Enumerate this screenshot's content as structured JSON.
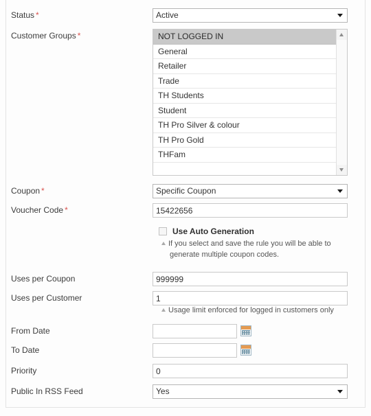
{
  "form": {
    "rows": [
      {
        "id": "status",
        "label": "Status",
        "required": true,
        "type": "select",
        "value": "Active"
      },
      {
        "id": "customer_groups",
        "label": "Customer Groups",
        "required": true,
        "type": "multiselect",
        "options": [
          "NOT LOGGED IN",
          "General",
          "Retailer",
          "Trade",
          "TH Students",
          "Student",
          "TH Pro Silver & colour",
          "TH Pro Gold",
          "THFam"
        ],
        "selected": [
          "NOT LOGGED IN"
        ]
      },
      {
        "id": "coupon",
        "label": "Coupon",
        "required": true,
        "type": "select",
        "value": "Specific Coupon"
      },
      {
        "id": "voucher_code",
        "label": "Voucher Code",
        "required": true,
        "type": "text",
        "value": "15422656"
      },
      {
        "id": "use_auto_generation",
        "label": "Use Auto Generation",
        "type": "checkbox",
        "checked": false,
        "note_line1": "If you select and save the rule you will be able to",
        "note_line2": "generate multiple coupon codes."
      },
      {
        "id": "uses_per_coupon",
        "label": "Uses per Coupon",
        "required": false,
        "type": "text",
        "value": "999999"
      },
      {
        "id": "uses_per_customer",
        "label": "Uses per Customer",
        "required": false,
        "type": "text",
        "value": "1",
        "note_line1": "Usage limit enforced for logged in customers only"
      },
      {
        "id": "from_date",
        "label": "From Date",
        "required": false,
        "type": "date",
        "value": "",
        "icon": "calendar-icon"
      },
      {
        "id": "to_date",
        "label": "To Date",
        "required": false,
        "type": "date",
        "value": "",
        "icon": "calendar-icon"
      },
      {
        "id": "priority",
        "label": "Priority",
        "required": false,
        "type": "text",
        "value": "0"
      },
      {
        "id": "public_in_rss_feed",
        "label": "Public In RSS Feed",
        "required": false,
        "type": "select",
        "value": "Yes"
      }
    ],
    "required_marker": "*",
    "colors": {
      "required": "#d9534f",
      "selected_row": "#c9c9c9",
      "calendar_header": "#e59b52",
      "border": "#c9c9c9",
      "background": "#fdfdfd"
    }
  }
}
